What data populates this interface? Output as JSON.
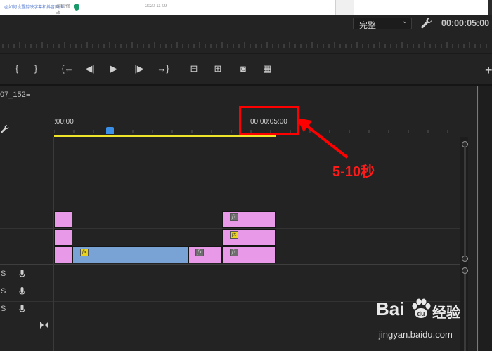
{
  "browser_strip": {
    "link_text": "@如何设置剪映字幕和抖音同步",
    "tag": "编辑/修改",
    "date": "2020-11-09"
  },
  "header": {
    "resolution_value": "完整",
    "playhead_timecode": "00:00:05:00"
  },
  "transport": {
    "buttons": [
      {
        "name": "mark-in",
        "glyph": "{"
      },
      {
        "name": "mark-out",
        "glyph": "}"
      },
      {
        "name": "go-to-in",
        "glyph": "{←"
      },
      {
        "name": "step-back",
        "glyph": "◀|"
      },
      {
        "name": "play",
        "glyph": "▶"
      },
      {
        "name": "step-forward",
        "glyph": "|▶"
      },
      {
        "name": "go-to-out",
        "glyph": "→}"
      },
      {
        "name": "lift",
        "glyph": "⊟"
      },
      {
        "name": "extract",
        "glyph": "⊞"
      },
      {
        "name": "export-frame",
        "glyph": "◙"
      },
      {
        "name": "comparison-view",
        "glyph": "▦"
      }
    ],
    "add_glyph": "+"
  },
  "timeline": {
    "sequence_name": "07_152",
    "menu_glyph": "≡",
    "timecode_start": ":00:00",
    "timecode_mark": "00:00:05:00",
    "audio_tracks": [
      {
        "label": "S"
      },
      {
        "label": "S"
      },
      {
        "label": "S"
      }
    ],
    "fx_label": "fx"
  },
  "annotation": {
    "text": "5-10秒",
    "color": "#ff0000"
  },
  "watermark": {
    "brand": "Bai",
    "brand_end": "经验",
    "url": "jingyan.baidu.com"
  },
  "colors": {
    "accent_blue": "#2d8ceb",
    "work_area_yellow": "#f0e42a",
    "clip_pink": "#e89ae8",
    "clip_blue": "#7aa3d5"
  }
}
